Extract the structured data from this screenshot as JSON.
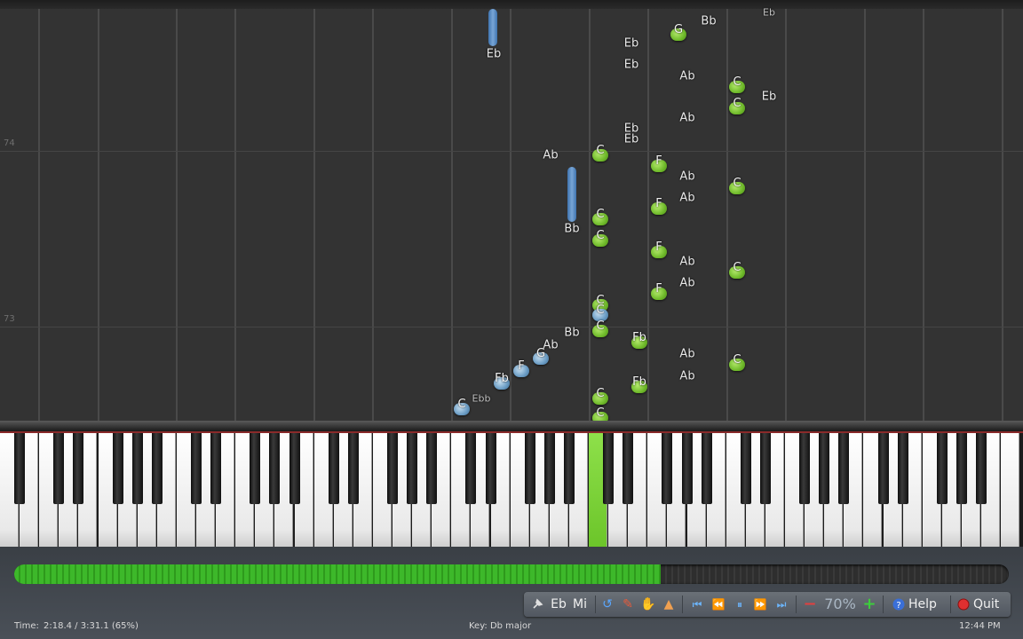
{
  "measures": {
    "m74": "74",
    "m73": "73"
  },
  "notes": {
    "eb_top": "Eb",
    "bb_top": "Bb",
    "eb_tr": "Eb",
    "g1": "G",
    "eb1": "Eb",
    "eb2": "Eb",
    "ab1": "Ab",
    "c1": "C",
    "eb3": "Eb",
    "c2": "C",
    "ab2": "Ab",
    "eb4": "Eb",
    "eb5": "Eb",
    "ab3": "Ab",
    "c3": "C",
    "f1": "F",
    "ab4": "Ab",
    "c4": "C",
    "ab5": "Ab",
    "f2": "F",
    "bb1": "Bb",
    "c5": "C",
    "c6": "C",
    "f3": "F",
    "ab6": "Ab",
    "c7": "C",
    "f4": "F",
    "ab7": "Ab",
    "c8": "C",
    "c9": "C",
    "c10": "C",
    "fb1": "Fb",
    "bb2": "Bb",
    "ab8": "Ab",
    "g2": "G",
    "f5": "F",
    "fb2": "Fb",
    "ab9": "Ab",
    "c11": "C",
    "ab10": "Ab",
    "fb3": "Fb",
    "c12": "C",
    "ebb": "Ebb",
    "c13": "C",
    "c14": "C"
  },
  "progress": {
    "fraction": 0.65
  },
  "toolbar": {
    "labels_label": "Eb",
    "midi_label": "Mi",
    "zoom": "70%",
    "help_label": "Help",
    "quit_label": "Quit"
  },
  "status": {
    "time_label": "Time:",
    "time_value": "2:18.4 / 3:31.1 (65%)",
    "key_text": "Key: Db major",
    "clock": "12:44 PM"
  },
  "colors": {
    "accent_green": "#6cc52a",
    "note_blue": "#6a9cc4",
    "quit_red": "#e03030",
    "help_blue": "#3a6fd8"
  }
}
